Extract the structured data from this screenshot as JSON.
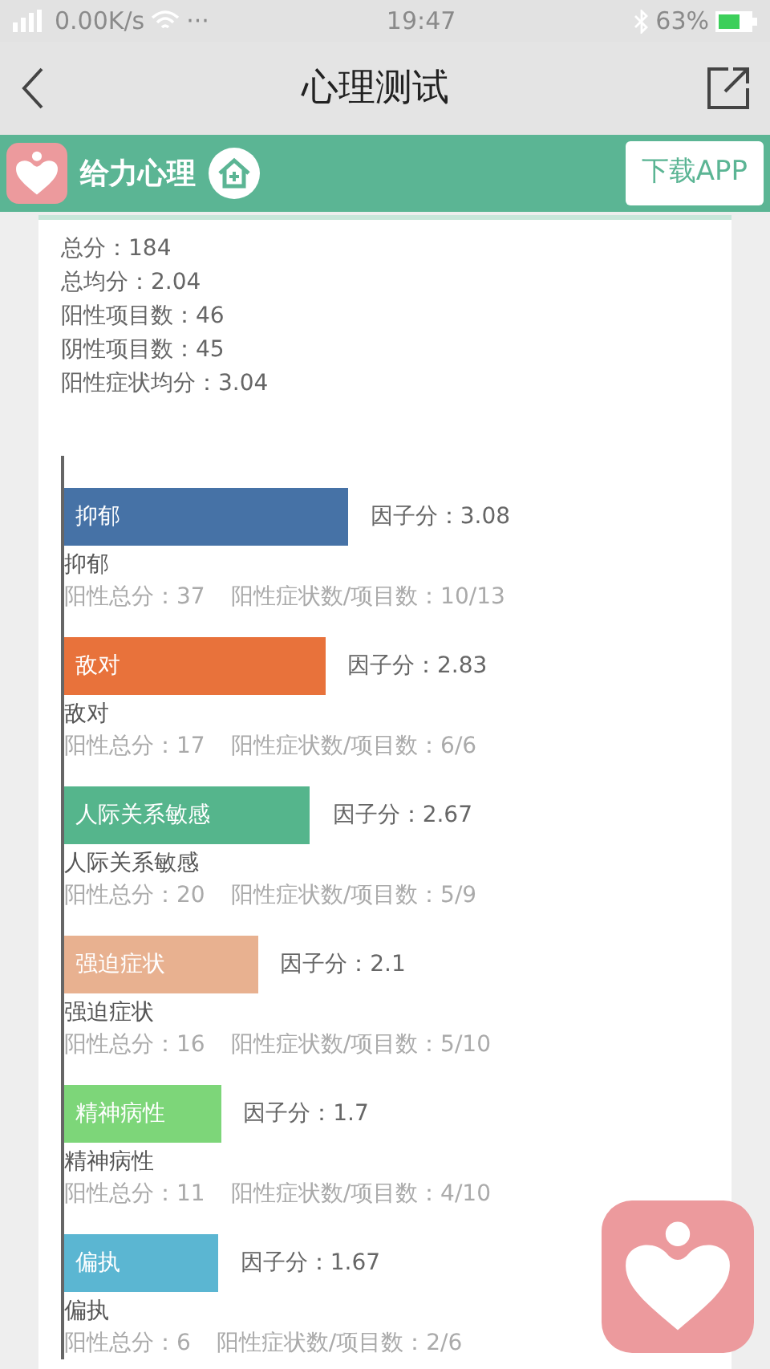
{
  "status_bar": {
    "network": "0.00K/s",
    "more": "···",
    "time": "19:47",
    "battery": "63%"
  },
  "nav": {
    "title": "心理测试"
  },
  "banner": {
    "brand": "给力心理",
    "download": "下载APP"
  },
  "summary": [
    "总分：184",
    "总均分：2.04",
    "阳性项目数：46",
    "阴性项目数：45",
    "阳性症状均分：3.04"
  ],
  "factors": [
    {
      "name": "抑郁",
      "color": "#4672a6",
      "score": "因子分：3.08",
      "caption": "抑郁",
      "positive_total": "阳性总分：37",
      "ratio": "阳性症状数/项目数：10/13"
    },
    {
      "name": "敌对",
      "color": "#e8723b",
      "score": "因子分：2.83",
      "caption": "敌对",
      "positive_total": "阳性总分：17",
      "ratio": "阳性症状数/项目数：6/6"
    },
    {
      "name": "人际关系敏感",
      "color": "#55b58c",
      "score": "因子分：2.67",
      "caption": "人际关系敏感",
      "positive_total": "阳性总分：20",
      "ratio": "阳性症状数/项目数：5/9"
    },
    {
      "name": "强迫症状",
      "color": "#e8b190",
      "score": "因子分：2.1",
      "caption": "强迫症状",
      "positive_total": "阳性总分：16",
      "ratio": "阳性症状数/项目数：5/10"
    },
    {
      "name": "精神病性",
      "color": "#7dd679",
      "score": "因子分：1.7",
      "caption": "精神病性",
      "positive_total": "阳性总分：11",
      "ratio": "阳性症状数/项目数：4/10"
    },
    {
      "name": "偏执",
      "color": "#5bb6d2",
      "score": "因子分：1.67",
      "caption": "偏执",
      "positive_total": "阳性总分：6",
      "ratio": "阳性症状数/项目数：2/6"
    }
  ]
}
